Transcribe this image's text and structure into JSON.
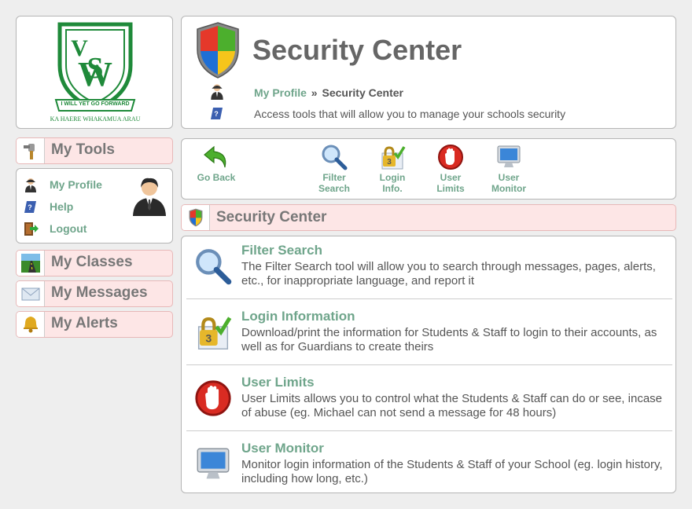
{
  "logo": {
    "letters": "VSW",
    "motto": "I WILL YET GO FORWARD",
    "subtitle": "KA HAERE WHAKAMUA ARAU"
  },
  "sidebar": {
    "my_tools": "My Tools",
    "profile_links": [
      {
        "label": "My Profile",
        "icon": "person-icon"
      },
      {
        "label": "Help",
        "icon": "help-book-icon"
      },
      {
        "label": "Logout",
        "icon": "logout-door-icon"
      }
    ],
    "my_classes": "My Classes",
    "my_messages": "My Messages",
    "my_alerts": "My Alerts"
  },
  "header": {
    "title": "Security Center",
    "breadcrumb": {
      "link": "My Profile",
      "separator": "»",
      "current": "Security Center"
    },
    "description": "Access tools that will allow you to manage your schools security"
  },
  "toolbar": {
    "go_back": "Go Back",
    "tools": [
      {
        "label": "Filter\nSearch",
        "icon": "magnifier-icon"
      },
      {
        "label": "Login\nInfo.",
        "icon": "lock-check-icon"
      },
      {
        "label": "User\nLimits",
        "icon": "stop-hand-icon"
      },
      {
        "label": "User\nMonitor",
        "icon": "monitor-icon"
      }
    ]
  },
  "section_title": "Security Center",
  "tools": [
    {
      "title": "Filter Search",
      "description": "The Filter Search tool will allow you to search through messages, pages, alerts, etc., for inappropriate language, and report it"
    },
    {
      "title": "Login Information",
      "description": "Download/print the information for Students & Staff to login to their accounts, as well as for Guardians to create theirs"
    },
    {
      "title": "User Limits",
      "description": "User Limits allows you to control what the Students & Staff can do or see, incase of abuse (eg. Michael can not send a message for 48 hours)"
    },
    {
      "title": "User Monitor",
      "description": "Monitor login information of the Students & Staff of your School (eg. login history, including how long, etc.)"
    }
  ],
  "colors": {
    "link_green": "#6fa58b",
    "pink_header": "#fde6e6",
    "logo_green": "#1f8a3a"
  }
}
